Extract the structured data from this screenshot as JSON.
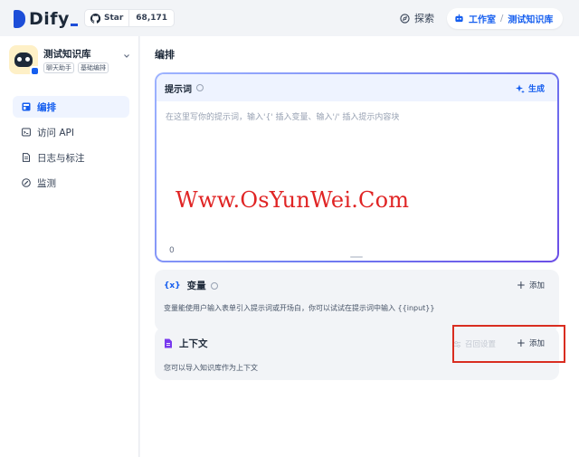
{
  "topbar": {
    "logo_text": "Dify",
    "github_star_label": "Star",
    "github_star_count": "68,171",
    "explore_label": "探索",
    "workspace_label": "工作室",
    "workspace_separator": "/",
    "current_dataset": "测试知识库"
  },
  "sidebar": {
    "dataset_name": "测试知识库",
    "tags": [
      "聊天助手",
      "基础编排"
    ],
    "items": [
      {
        "label": "编排",
        "icon": "layout-icon",
        "active": true
      },
      {
        "label": "访问 API",
        "icon": "terminal-icon",
        "active": false
      },
      {
        "label": "日志与标注",
        "icon": "file-text-icon",
        "active": false
      },
      {
        "label": "监测",
        "icon": "gauge-icon",
        "active": false
      }
    ]
  },
  "main": {
    "title": "编排",
    "prompt": {
      "label": "提示词",
      "generate_label": "生成",
      "placeholder": "在这里写你的提示词，输入'{' 插入变量、输入'/' 插入提示内容块",
      "char_count": "0"
    },
    "variables": {
      "icon_text": "{x}",
      "label": "变量",
      "add_label": "添加",
      "description": "变量能使用户输入表单引入提示词或开场白，你可以试试在提示词中输入 {{input}}"
    },
    "context": {
      "label": "上下文",
      "recall_label": "召回设置",
      "add_label": "添加",
      "description": "您可以导入知识库作为上下文"
    }
  },
  "watermark": "Www.OsYunWei.Com",
  "colors": {
    "accent": "#155eef",
    "highlight": "#d92d20",
    "watermark": "#e02424"
  }
}
